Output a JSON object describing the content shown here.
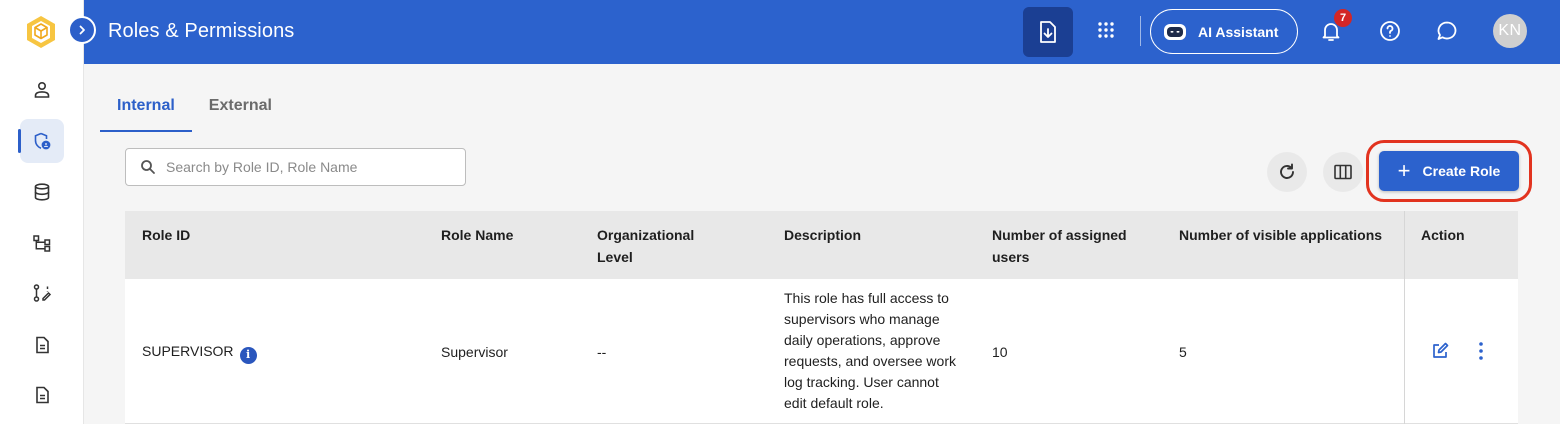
{
  "header": {
    "title": "Roles & Permissions",
    "ai_label": "AI Assistant",
    "notification_count": "7",
    "avatar_initials": "KN"
  },
  "sidebar": {
    "items": [
      {
        "icon": "user-icon"
      },
      {
        "icon": "security-role-icon",
        "active": true
      },
      {
        "icon": "database-icon"
      },
      {
        "icon": "hierarchy-icon"
      },
      {
        "icon": "workflow-icon"
      },
      {
        "icon": "document-icon"
      },
      {
        "icon": "document-icon"
      }
    ]
  },
  "tabs": [
    {
      "label": "Internal",
      "active": true
    },
    {
      "label": "External",
      "active": false
    }
  ],
  "search": {
    "placeholder": "Search by Role ID, Role Name",
    "value": ""
  },
  "toolbar": {
    "create_label": "Create Role"
  },
  "table": {
    "columns": [
      "Role ID",
      "Role Name",
      "Organizational Level",
      "Description",
      "Number of assigned users",
      "Number of visible applications",
      "Action"
    ],
    "rows": [
      {
        "role_id": "SUPERVISOR",
        "role_name": "Supervisor",
        "org_level": "--",
        "description": "This role has full access to supervisors who manage daily operations, approve requests, and oversee work log tracking. User cannot edit default role.",
        "assigned_users": "10",
        "visible_apps": "5"
      }
    ]
  },
  "colors": {
    "brand": "#2c62cd",
    "highlight": "#e2331f",
    "badge": "#d32626"
  }
}
